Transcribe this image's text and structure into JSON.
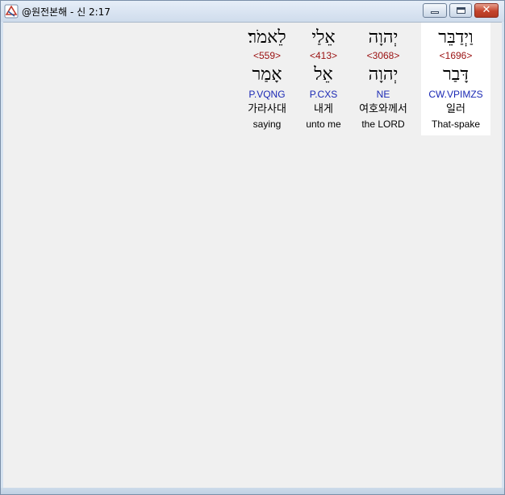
{
  "window": {
    "title": "@원전본해 - 신 2:17",
    "app_icon": "app-logo-icon",
    "controls": {
      "minimize": "minimize-icon",
      "maximize": "maximize-icon",
      "close": "close-icon",
      "close_glyph": "✕"
    }
  },
  "colors": {
    "strong": "#9a1010",
    "morph": "#1a28b4",
    "selected_background": "#ffffff"
  },
  "words": [
    {
      "hebrew": "וַיְדַבֵּר",
      "strong": "<1696>",
      "lemma": "דָּבַר",
      "morph": "CW.VPIMZS",
      "korean": "일러",
      "english": "That-spake",
      "selected": true
    },
    {
      "hebrew": "יְהוָה",
      "strong": "<3068>",
      "lemma": "יְהוָה",
      "morph": "NE",
      "korean": "여호와께서",
      "english": "the LORD",
      "selected": false
    },
    {
      "hebrew": "אֵלַי",
      "strong": "<413>",
      "lemma": "אֵל",
      "morph": "P.CXS",
      "korean": "내게",
      "english": "unto me",
      "selected": false
    },
    {
      "hebrew": "לֵאמֹר׃",
      "strong": "<559>",
      "lemma": "אָמַר",
      "morph": "P.VQNG",
      "korean": "가라사대",
      "english": "saying",
      "selected": false
    }
  ]
}
